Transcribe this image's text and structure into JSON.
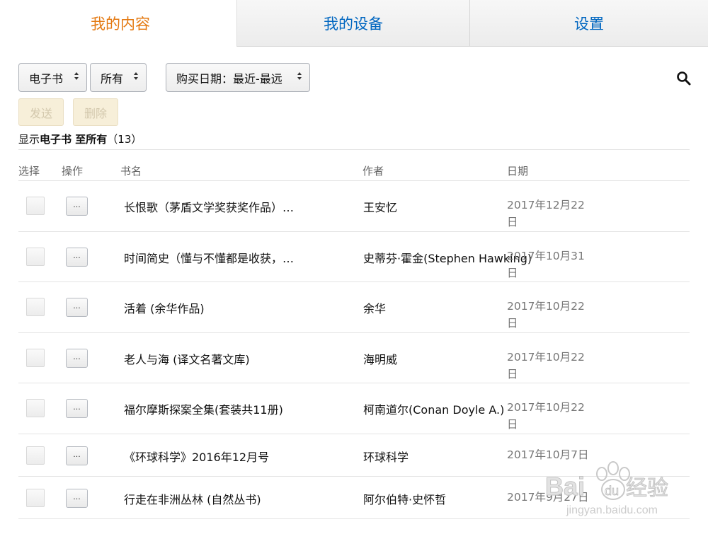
{
  "tabs": [
    {
      "label": "我的内容",
      "active": true
    },
    {
      "label": "我的设备",
      "active": false
    },
    {
      "label": "设置",
      "active": false
    }
  ],
  "filters": {
    "type": "电子书",
    "scope": "所有",
    "sort": "购买日期：最近-最远"
  },
  "actions": {
    "send": "发送",
    "delete": "删除"
  },
  "summary": {
    "prefix": "显示",
    "type": "电子书",
    "to": " 至",
    "scope": "所有",
    "count": "（13）"
  },
  "columns": {
    "select": "选择",
    "action": "操作",
    "title": "书名",
    "author": "作者",
    "date": "日期"
  },
  "op_label": "...",
  "rows": [
    {
      "title": "长恨歌（茅盾文学奖获奖作品）…",
      "author": "王安忆",
      "date": "2017年12月22日"
    },
    {
      "title": "时间简史（懂与不懂都是收获，…",
      "author": "史蒂芬·霍金(Stephen Hawking)",
      "date": "2017年10月31日"
    },
    {
      "title": "活着 (余华作品)",
      "author": "余华",
      "date": "2017年10月22日"
    },
    {
      "title": "老人与海 (译文名著文库)",
      "author": "海明威",
      "date": "2017年10月22日"
    },
    {
      "title": "福尔摩斯探案全集(套装共11册)",
      "author": "柯南道尔(Conan Doyle A.)",
      "date": "2017年10月22日"
    },
    {
      "title": "《环球科学》2016年12月号",
      "author": "环球科学",
      "date": "2017年10月7日"
    },
    {
      "title": "行走在非洲丛林 (自然丛书)",
      "author": "阿尔伯特·史怀哲",
      "date": "2017年9月27日"
    }
  ],
  "watermark": {
    "brand": "Bai du 经验",
    "url": "jingyan.baidu.com"
  },
  "colors": {
    "active_tab": "#e47911",
    "link": "#0066c0"
  }
}
